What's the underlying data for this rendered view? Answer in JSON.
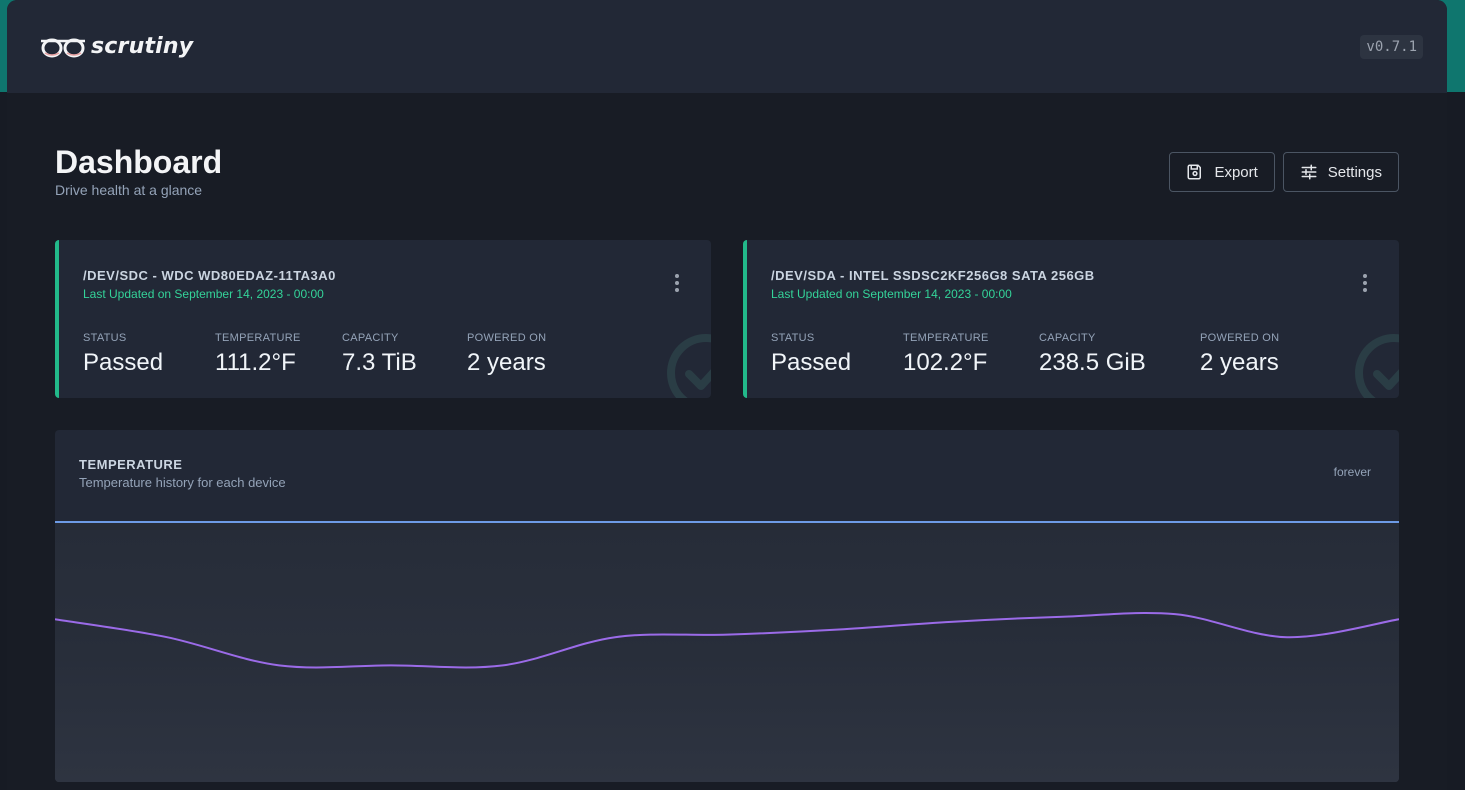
{
  "app": {
    "name": "scrutiny",
    "version": "v0.7.1"
  },
  "page": {
    "title": "Dashboard",
    "subtitle": "Drive health at a glance"
  },
  "actions": {
    "export_label": "Export",
    "settings_label": "Settings"
  },
  "devices": [
    {
      "title": "/DEV/SDC - WDC WD80EDAZ-11TA3A0",
      "updated": "Last Updated on September 14, 2023 - 00:00",
      "status_label": "STATUS",
      "status": "Passed",
      "temperature_label": "TEMPERATURE",
      "temperature": "111.2°F",
      "capacity_label": "CAPACITY",
      "capacity": "7.3 TiB",
      "powered_label": "POWERED ON",
      "powered_on": "2 years"
    },
    {
      "title": "/DEV/SDA - INTEL SSDSC2KF256G8 SATA 256GB",
      "updated": "Last Updated on September 14, 2023 - 00:00",
      "status_label": "STATUS",
      "status": "Passed",
      "temperature_label": "TEMPERATURE",
      "temperature": "102.2°F",
      "capacity_label": "CAPACITY",
      "capacity": "238.5 GiB",
      "powered_label": "POWERED ON",
      "powered_on": "2 years"
    }
  ],
  "temperature_chart": {
    "title": "TEMPERATURE",
    "subtitle": "Temperature history for each device",
    "range": "forever",
    "colors": {
      "series_a": "#6d9be6",
      "series_b": "#9b6be8",
      "fill": "#2a303d"
    }
  },
  "chart_data": {
    "type": "area",
    "title": "TEMPERATURE",
    "x": [
      0,
      1,
      2,
      3,
      4,
      5,
      6,
      7,
      8,
      9,
      10,
      11,
      12
    ],
    "series": [
      {
        "values": [
          1,
          1,
          1,
          1,
          1,
          1,
          1,
          1,
          1,
          1,
          1,
          1,
          1
        ]
      },
      {
        "values": [
          0.62,
          0.55,
          0.44,
          0.44,
          0.44,
          0.55,
          0.56,
          0.58,
          0.61,
          0.63,
          0.64,
          0.55,
          0.62
        ]
      }
    ],
    "legend": "none",
    "grid": false
  }
}
